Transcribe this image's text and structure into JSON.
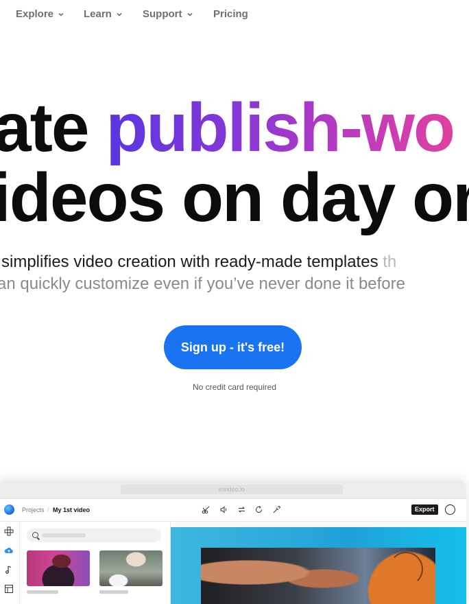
{
  "nav": {
    "items": [
      {
        "label": "Explore",
        "has_dropdown": true
      },
      {
        "label": "Learn",
        "has_dropdown": true
      },
      {
        "label": "Support",
        "has_dropdown": true
      },
      {
        "label": "Pricing",
        "has_dropdown": false
      }
    ]
  },
  "hero": {
    "line1_plain": "ate ",
    "line1_gradient": "publish-wo",
    "line2": "ideos on day or",
    "subtitle_line1": "simplifies video creation with ready-made templates ",
    "subtitle_line1_faded": "th",
    "subtitle_line2": "an quickly customize even if you’ve never done it before",
    "cta_label": "Sign up - it's free!",
    "cta_note": "No credit card required"
  },
  "app_window": {
    "url": "invideo.io",
    "breadcrumb": {
      "root": "Projects",
      "separator": "/",
      "current": "My 1st video"
    },
    "export_label": "Export",
    "toolbar_icons": [
      "scissors-icon",
      "volume-icon",
      "swap-icon",
      "rotate-icon",
      "eyedropper-icon"
    ],
    "rail_icons": [
      "layout-icon",
      "upload-cloud-icon",
      "music-icon",
      "template-icon"
    ]
  },
  "colors": {
    "cta_blue": "#1a74f1",
    "gradient_start": "#5a35e0",
    "gradient_end": "#e0409e"
  }
}
